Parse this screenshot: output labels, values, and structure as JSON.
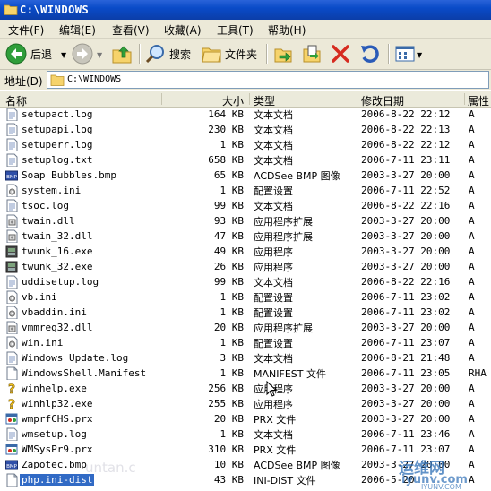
{
  "window": {
    "title": "C:\\WINDOWS"
  },
  "menu": [
    "文件(F)",
    "编辑(E)",
    "查看(V)",
    "收藏(A)",
    "工具(T)",
    "帮助(H)"
  ],
  "toolbar": {
    "back_label": "后退",
    "search_label": "搜索",
    "folders_label": "文件夹"
  },
  "address": {
    "label": "地址(D)",
    "value": "C:\\WINDOWS"
  },
  "columns": {
    "name": "名称",
    "size": "大小",
    "type": "类型",
    "modified": "修改日期",
    "attributes": "属性"
  },
  "files": [
    {
      "name": "setupact.log",
      "size": "164 KB",
      "type": "文本文档",
      "modified": "2006-8-22 22:12",
      "attr": "A",
      "icon": "text-file-icon"
    },
    {
      "name": "setupapi.log",
      "size": "230 KB",
      "type": "文本文档",
      "modified": "2006-8-22 22:13",
      "attr": "A",
      "icon": "text-file-icon"
    },
    {
      "name": "setuperr.log",
      "size": "1 KB",
      "type": "文本文档",
      "modified": "2006-8-22 22:12",
      "attr": "A",
      "icon": "text-file-icon"
    },
    {
      "name": "setuplog.txt",
      "size": "658 KB",
      "type": "文本文档",
      "modified": "2006-7-11 23:11",
      "attr": "A",
      "icon": "text-file-icon"
    },
    {
      "name": "Soap Bubbles.bmp",
      "size": "65 KB",
      "type": "ACDSee BMP 图像",
      "modified": "2003-3-27 20:00",
      "attr": "A",
      "icon": "bmp-file-icon"
    },
    {
      "name": "system.ini",
      "size": "1 KB",
      "type": "配置设置",
      "modified": "2006-7-11 22:52",
      "attr": "A",
      "icon": "ini-file-icon"
    },
    {
      "name": "tsoc.log",
      "size": "99 KB",
      "type": "文本文档",
      "modified": "2006-8-22 22:16",
      "attr": "A",
      "icon": "text-file-icon"
    },
    {
      "name": "twain.dll",
      "size": "93 KB",
      "type": "应用程序扩展",
      "modified": "2003-3-27 20:00",
      "attr": "A",
      "icon": "dll-file-icon"
    },
    {
      "name": "twain_32.dll",
      "size": "47 KB",
      "type": "应用程序扩展",
      "modified": "2003-3-27 20:00",
      "attr": "A",
      "icon": "dll-file-icon"
    },
    {
      "name": "twunk_16.exe",
      "size": "49 KB",
      "type": "应用程序",
      "modified": "2003-3-27 20:00",
      "attr": "A",
      "icon": "scanner-exe-icon"
    },
    {
      "name": "twunk_32.exe",
      "size": "26 KB",
      "type": "应用程序",
      "modified": "2003-3-27 20:00",
      "attr": "A",
      "icon": "scanner-exe-icon"
    },
    {
      "name": "uddisetup.log",
      "size": "99 KB",
      "type": "文本文档",
      "modified": "2006-8-22 22:16",
      "attr": "A",
      "icon": "text-file-icon"
    },
    {
      "name": "vb.ini",
      "size": "1 KB",
      "type": "配置设置",
      "modified": "2006-7-11 23:02",
      "attr": "A",
      "icon": "ini-file-icon"
    },
    {
      "name": "vbaddin.ini",
      "size": "1 KB",
      "type": "配置设置",
      "modified": "2006-7-11 23:02",
      "attr": "A",
      "icon": "ini-file-icon"
    },
    {
      "name": "vmmreg32.dll",
      "size": "20 KB",
      "type": "应用程序扩展",
      "modified": "2003-3-27 20:00",
      "attr": "A",
      "icon": "dll-file-icon"
    },
    {
      "name": "win.ini",
      "size": "1 KB",
      "type": "配置设置",
      "modified": "2006-7-11 23:07",
      "attr": "A",
      "icon": "ini-file-icon"
    },
    {
      "name": "Windows Update.log",
      "size": "3 KB",
      "type": "文本文档",
      "modified": "2006-8-21 21:48",
      "attr": "A",
      "icon": "text-file-icon"
    },
    {
      "name": "WindowsShell.Manifest",
      "size": "1 KB",
      "type": "MANIFEST 文件",
      "modified": "2006-7-11 23:05",
      "attr": "RHA",
      "icon": "generic-file-icon"
    },
    {
      "name": "winhelp.exe",
      "size": "256 KB",
      "type": "应用程序",
      "modified": "2003-3-27 20:00",
      "attr": "A",
      "icon": "help-exe-icon"
    },
    {
      "name": "winhlp32.exe",
      "size": "255 KB",
      "type": "应用程序",
      "modified": "2003-3-27 20:00",
      "attr": "A",
      "icon": "help-exe-icon"
    },
    {
      "name": "wmprfCHS.prx",
      "size": "20 KB",
      "type": "PRX 文件",
      "modified": "2003-3-27 20:00",
      "attr": "A",
      "icon": "prx-file-icon"
    },
    {
      "name": "wmsetup.log",
      "size": "1 KB",
      "type": "文本文档",
      "modified": "2006-7-11 23:46",
      "attr": "A",
      "icon": "text-file-icon"
    },
    {
      "name": "WMSysPr9.prx",
      "size": "310 KB",
      "type": "PRX 文件",
      "modified": "2006-7-11 23:07",
      "attr": "A",
      "icon": "prx-file-icon"
    },
    {
      "name": "Zapotec.bmp",
      "size": "10 KB",
      "type": "ACDSee BMP 图像",
      "modified": "2003-3-27 20:00",
      "attr": "A",
      "icon": "bmp-file-icon"
    },
    {
      "name": "php.ini-dist",
      "size": "43 KB",
      "type": "INI-DIST 文件",
      "modified": "2006-5-20",
      "attr": "A",
      "icon": "generic-file-icon",
      "selected": true
    }
  ],
  "watermark": {
    "line1": "运维网",
    "line2": "iyunv.com",
    "line3": "IYUNV.COM"
  }
}
